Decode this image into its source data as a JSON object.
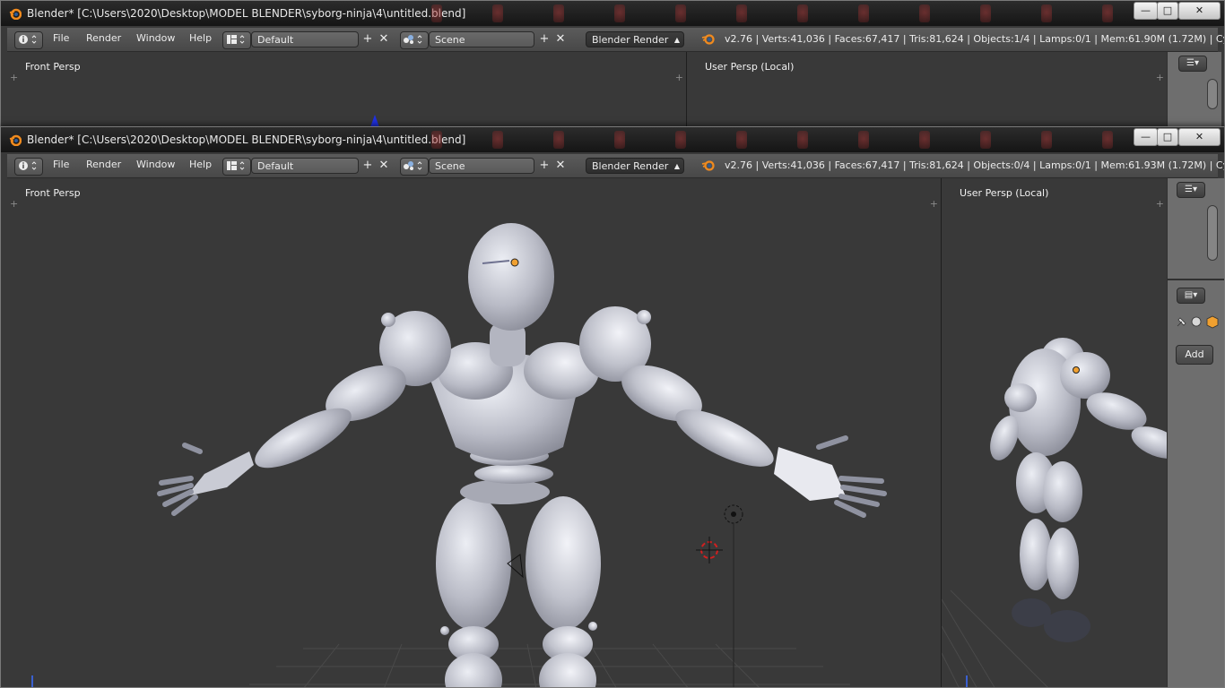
{
  "back_window": {
    "title": "Blender* [C:\\Users\\2020\\Desktop\\MODEL BLENDER\\syborg-ninja\\4\\untitled.blend]",
    "menus": [
      "File",
      "Render",
      "Window",
      "Help"
    ],
    "layout": "Default",
    "scene": "Scene",
    "engine": "Blender Render",
    "stats": "v2.76 | Verts:41,036 | Faces:67,417 | Tris:81,624 | Objects:1/4 | Lamps:0/1 | Mem:61.90M (1.72M) | Cylinder",
    "left_view": "Front Persp",
    "right_view": "User Persp (Local)"
  },
  "front_window": {
    "title": "Blender* [C:\\Users\\2020\\Desktop\\MODEL BLENDER\\syborg-ninja\\4\\untitled.blend]",
    "menus": [
      "File",
      "Render",
      "Window",
      "Help"
    ],
    "layout": "Default",
    "scene": "Scene",
    "engine": "Blender Render",
    "stats": "v2.76 | Verts:41,036 | Faces:67,417 | Tris:81,624 | Objects:0/4 | Lamps:0/1 | Mem:61.93M (1.72M) | Cylinder",
    "left_view": "Front Persp",
    "right_view": "User Persp (Local)",
    "add_button": "Add"
  },
  "window_controls": {
    "minimize": "—",
    "maximize": "□",
    "close": "✕"
  },
  "icons": {
    "blender": "blender-logo-icon",
    "info": "info-editor-icon",
    "layout": "screen-layout-icon",
    "scene": "scene-icon",
    "add": "plus-icon",
    "remove": "x-icon"
  },
  "colors": {
    "viewport": "#393939",
    "header": "#4f4f4f",
    "model": "#c3c5cf",
    "cursor": "#d02020",
    "blender_orange": "#f08a1e"
  }
}
